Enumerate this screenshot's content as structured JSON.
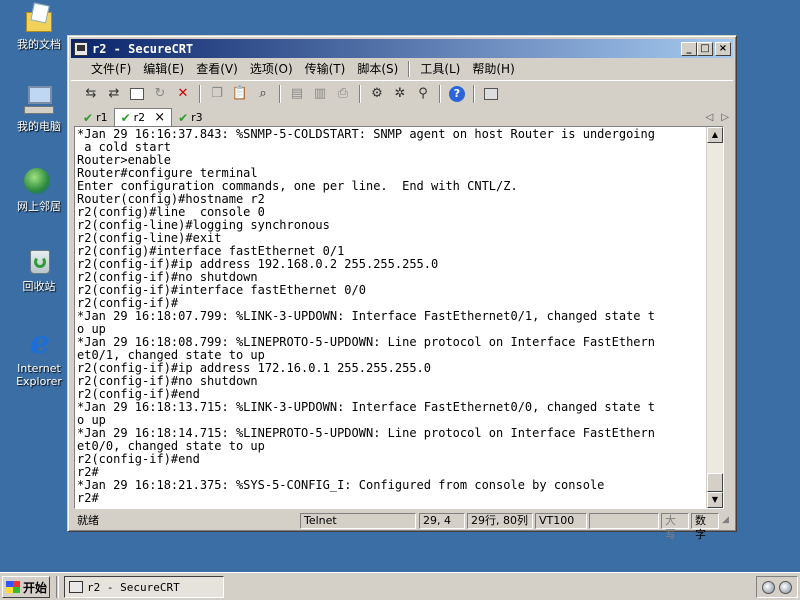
{
  "desktop": {
    "icons": [
      {
        "label": "我的文档"
      },
      {
        "label": "我的电脑"
      },
      {
        "label": "网上邻居"
      },
      {
        "label": "回收站"
      },
      {
        "label": "Internet Explorer"
      }
    ]
  },
  "window": {
    "title": "r2 - SecureCRT",
    "controls": {
      "minimize": "_",
      "maximize": "□",
      "close": "×"
    }
  },
  "menu": {
    "items": [
      "文件(F)",
      "编辑(E)",
      "查看(V)",
      "选项(O)",
      "传输(T)",
      "脚本(S)",
      "工具(L)",
      "帮助(H)"
    ]
  },
  "tabs": [
    {
      "label": "r1",
      "status": "connected"
    },
    {
      "label": "r2",
      "status": "connected",
      "active": true,
      "close": "×"
    },
    {
      "label": "r3",
      "status": "connected"
    }
  ],
  "terminal": {
    "lines": [
      "*Jan 29 16:16:37.843: %SNMP-5-COLDSTART: SNMP agent on host Router is undergoing",
      " a cold start",
      "Router>enable",
      "Router#configure terminal",
      "Enter configuration commands, one per line.  End with CNTL/Z.",
      "Router(config)#hostname r2",
      "r2(config)#line  console 0",
      "r2(config-line)#logging synchronous",
      "r2(config-line)#exit",
      "r2(config)#interface fastEthernet 0/1",
      "r2(config-if)#ip address 192.168.0.2 255.255.255.0",
      "r2(config-if)#no shutdown",
      "r2(config-if)#interface fastEthernet 0/0",
      "r2(config-if)#",
      "*Jan 29 16:18:07.799: %LINK-3-UPDOWN: Interface FastEthernet0/1, changed state t",
      "o up",
      "*Jan 29 16:18:08.799: %LINEPROTO-5-UPDOWN: Line protocol on Interface FastEthern",
      "et0/1, changed state to up",
      "r2(config-if)#ip address 172.16.0.1 255.255.255.0",
      "r2(config-if)#no shutdown",
      "r2(config-if)#end",
      "*Jan 29 16:18:13.715: %LINK-3-UPDOWN: Interface FastEthernet0/0, changed state t",
      "o up",
      "*Jan 29 16:18:14.715: %LINEPROTO-5-UPDOWN: Line protocol on Interface FastEthern",
      "et0/0, changed state to up",
      "r2(config-if)#end",
      "r2#",
      "*Jan 29 16:18:21.375: %SYS-5-CONFIG_I: Configured from console by console",
      "r2#"
    ]
  },
  "status": {
    "ready": "就绪",
    "protocol": "Telnet",
    "cursor": "29,  4",
    "size": "29行, 80列",
    "emulation": "VT100",
    "empty": "",
    "caps": "大写",
    "num": "数字"
  },
  "taskbar": {
    "start_label": "开始",
    "task_label": "r2 - SecureCRT"
  }
}
